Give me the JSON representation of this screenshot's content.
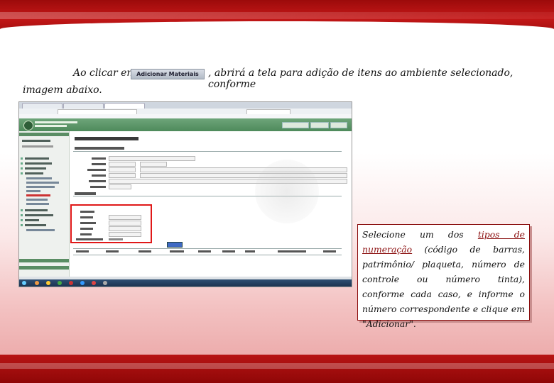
{
  "intro": {
    "before_button": "Ao clicar em",
    "button_label": "Adicionar Materiais",
    "after_button": ", abrirá a tela para adição de itens ao ambiente selecionado, conforme",
    "second_line": "imagem abaixo."
  },
  "callout": {
    "part1": "Selecione um dos ",
    "highlight": "tipos de numeração",
    "part2": " (código de barras, patrimônio/ plaqueta, número de controle ou número tinta), conforme cada caso, e informe o número correspondente e clique em \"Adicionar\"."
  },
  "colors": {
    "brand_red": "#c41818",
    "callout_border": "#8a0d0d",
    "highlight_box": "#e01818"
  },
  "screenshot": {
    "icons": [
      "browser-tabs",
      "address-bar",
      "university-logo",
      "sidebar-menu",
      "red-highlight-box",
      "adicionar-button",
      "windows-taskbar"
    ]
  }
}
